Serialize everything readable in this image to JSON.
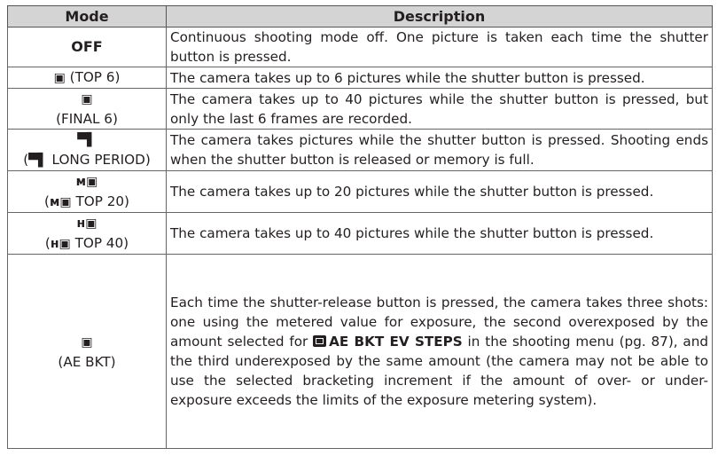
{
  "table": {
    "headers": {
      "mode": "Mode",
      "description": "Description"
    },
    "rows": [
      {
        "mode_label": "OFF",
        "description": "Continuous shooting mode off.  One picture is taken each time the shutter button is pressed."
      },
      {
        "icon": "▣",
        "mode_label": " (TOP 6)",
        "description": "The camera takes up to 6 pictures while the shutter button is pressed."
      },
      {
        "icon": "▣",
        "mode_label": "(FINAL 6)",
        "description": "The camera takes up to 40 pictures while the shutter button is pressed, but only the last 6 frames are recorded."
      },
      {
        "icon": "▀▌",
        "mode_prefix": "(",
        "inline_icon": "▀▌",
        "mode_label": " LONG PERIOD)",
        "description": "The camera takes pictures while the shutter button is pressed.  Shooting ends when the shutter button is released or memory is full."
      },
      {
        "icon": "ᴍ▣",
        "mode_prefix": "(",
        "inline_icon": "ᴍ▣",
        "mode_label": " TOP 20)",
        "description": "The camera takes up to 20 pictures while the shutter button is pressed."
      },
      {
        "icon": "ʜ▣",
        "mode_prefix": "(",
        "inline_icon": "ʜ▣",
        "mode_label": " TOP 40)",
        "description": "The camera takes up to 40 pictures while the shutter button is pressed."
      },
      {
        "icon": "▣",
        "mode_label": "(AE BKT)",
        "description_pre": "Each time the shutter-release button is pressed, the camera takes three shots: one using the metered value for exposure, the second overexposed by the amount selected for ",
        "description_menu": "AE BKT EV STEPS",
        "description_post": " in the shooting menu (pg. 87), and the third underexposed by the same amount (the camera may not be able to use the selected bracketing increment if the amount of over- or under-exposure exceeds the limits of the exposure metering system)."
      }
    ]
  }
}
